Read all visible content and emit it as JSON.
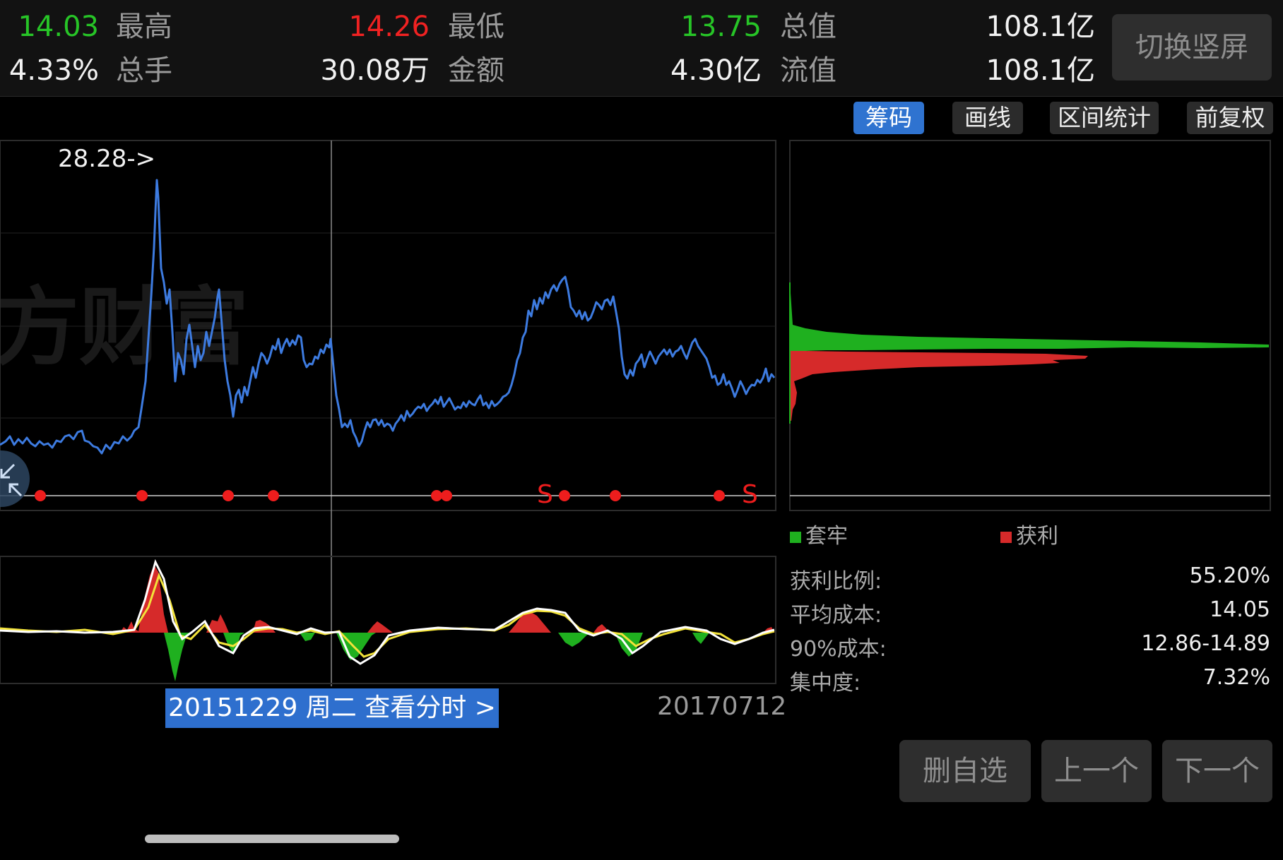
{
  "stats": {
    "row1": [
      {
        "value": "14.03",
        "label": "最高",
        "color": "green"
      },
      {
        "value": "14.26",
        "label": "最低",
        "color": "red"
      },
      {
        "value": "13.75",
        "label": "总值",
        "color": "green"
      },
      {
        "value": "108.1亿",
        "label": "",
        "color": "white"
      }
    ],
    "row2": [
      {
        "value": "4.33%",
        "label": "总手"
      },
      {
        "value": "30.08万",
        "label": "金额"
      },
      {
        "value": "4.30亿",
        "label": "流值"
      },
      {
        "value": "108.1亿",
        "label": ""
      }
    ],
    "toggle_label": "切换竖屏"
  },
  "toolbar": {
    "chips": "筹码",
    "draw": "画线",
    "interval": "区间统计",
    "adjust": "前复权"
  },
  "chart": {
    "peak_label": "28.28->",
    "sell_marker": "S",
    "watermark": "方财富"
  },
  "chips": {
    "legend_trapped": "套牢",
    "legend_profit": "获利",
    "metrics": [
      {
        "label": "获利比例:",
        "value": "55.20%"
      },
      {
        "label": "平均成本:",
        "value": "14.05"
      },
      {
        "label": "90%成本:",
        "value": "12.86-14.89"
      },
      {
        "label": "集中度:",
        "value": "7.32%"
      }
    ],
    "colors": {
      "trapped": "#1fb01f",
      "profit": "#d62a2a"
    }
  },
  "footer": {
    "date_badge": "20151229 周二 查看分时 >",
    "end_date": "20170712",
    "remove_watch": "删自选",
    "prev": "上一个",
    "next": "下一个"
  },
  "colors": {
    "price_line": "#3d7be0",
    "up": "#f02222",
    "down": "#27c527",
    "accent": "#2e6fce"
  }
}
